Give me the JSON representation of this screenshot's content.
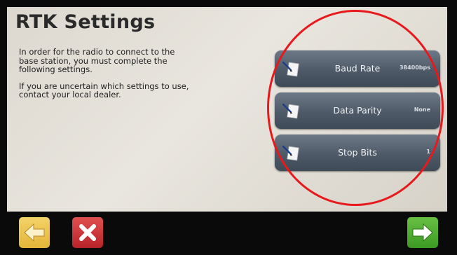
{
  "screen": {
    "title": "RTK Settings",
    "description": [
      "In order for the radio to connect to the\nbase station, you must complete the\nfollowing settings.",
      "If you are uncertain which settings to use,\n contact your local dealer."
    ]
  },
  "settings": [
    {
      "label": "Baud Rate",
      "value": "38400bps",
      "icon": "edit-note-icon"
    },
    {
      "label": "Data Parity",
      "value": "None",
      "icon": "edit-note-icon"
    },
    {
      "label": "Stop Bits",
      "value": "1",
      "icon": "edit-note-icon"
    }
  ],
  "nav": {
    "back_icon": "arrow-left-icon",
    "cancel_icon": "close-icon",
    "next_icon": "arrow-right-icon"
  },
  "colors": {
    "highlight": "#e8191c",
    "back": "#e3b437",
    "cancel": "#b8232a",
    "next": "#3c9a24"
  }
}
